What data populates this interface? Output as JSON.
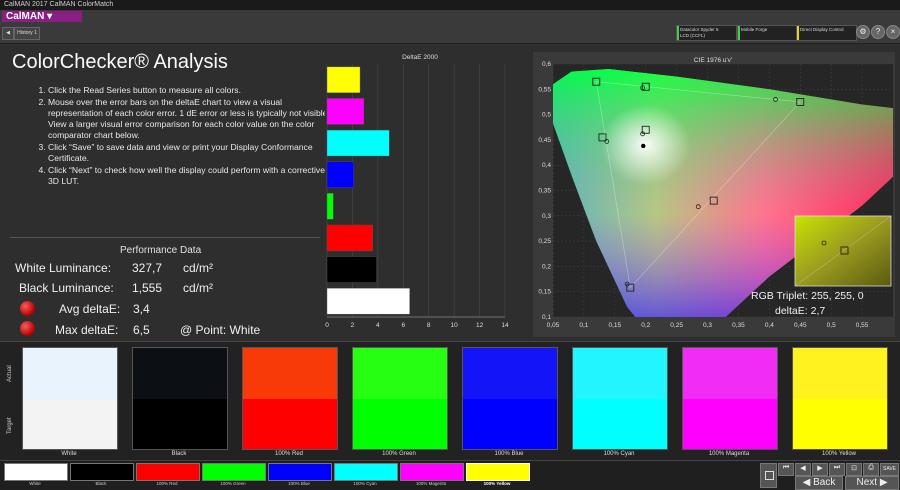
{
  "window": {
    "title": "CalMAN 2017 CalMAN ColorMatch"
  },
  "app": {
    "logo": "CalMAN ▾"
  },
  "history": {
    "tab_label": "History 1",
    "arrow": "◀"
  },
  "devices": [
    {
      "line1": "Datacolor Spyder 5",
      "line2": "LCD (CCFL)",
      "color": "#3fd14a"
    },
    {
      "line1": "Mobile Forge",
      "line2": "",
      "color": "#3fd14a"
    },
    {
      "line1": "Direct Display Control",
      "line2": "",
      "color": "#e8d21c"
    }
  ],
  "title_icons": [
    "gear-icon",
    "help-icon",
    "close-icon"
  ],
  "page": {
    "title": "ColorChecker® Analysis",
    "instructions": [
      "Click the Read Series button to measure all colors.",
      "Mouse over the error bars on the deltaE chart to view a visual representation of each color error. 1 dE error or less is typically not visible.",
      "View a larger visual error comparison for each color value on the color comparator chart below.",
      "Click “Save” to save data and view or print your Display Conformance Certificate.",
      "Click “Next” to check how well the display could perform with a corrective 3D LUT."
    ]
  },
  "performance": {
    "title": "Performance Data",
    "white_label": "White Luminance:",
    "white_value": "327,7",
    "white_unit": "cd/m²",
    "black_label": "Black Luminance:",
    "black_value": "1,555",
    "black_unit": "cd/m²",
    "avg_label": "Avg deltaE:",
    "avg_value": "3,4",
    "max_label": "Max deltaE:",
    "max_value": "6,5",
    "point_label": "@ Point: White"
  },
  "chart_data": [
    {
      "type": "bar",
      "title": "DeltaE 2000",
      "orientation": "horizontal",
      "categories": [
        "100% Yellow",
        "100% Magenta",
        "100% Cyan",
        "100% Blue",
        "100% Green",
        "100% Red",
        "Black",
        "White"
      ],
      "values": [
        2.6,
        2.9,
        4.9,
        2.1,
        0.5,
        3.6,
        3.9,
        6.5
      ],
      "colors": [
        "#ffff00",
        "#ff00ff",
        "#00ffff",
        "#0000ff",
        "#00ff00",
        "#ff0000",
        "#000000",
        "#ffffff"
      ],
      "xlim": [
        0,
        14
      ],
      "xticks": [
        "0",
        "2",
        "4",
        "6",
        "8",
        "10",
        "12",
        "14"
      ],
      "grid": true
    },
    {
      "type": "scatter",
      "title": "CIE 1976 u'v'",
      "xlim": [
        0.05,
        0.6
      ],
      "ylim": [
        0.1,
        0.6
      ],
      "xticks": [
        "0,05",
        "0,1",
        "0,15",
        "0,2",
        "0,25",
        "0,3",
        "0,35",
        "0,4",
        "0,45",
        "0,5",
        "0,55"
      ],
      "yticks": [
        "0,1",
        "0,15",
        "0,2",
        "0,25",
        "0,3",
        "0,35",
        "0,4",
        "0,45",
        "0,5",
        "0,55",
        "0,6"
      ],
      "target_points": [
        [
          0.12,
          0.565
        ],
        [
          0.2,
          0.555
        ],
        [
          0.45,
          0.525
        ],
        [
          0.13,
          0.455
        ],
        [
          0.2,
          0.47
        ],
        [
          0.31,
          0.33
        ],
        [
          0.175,
          0.158
        ]
      ],
      "measured_points": [
        [
          0.195,
          0.553
        ],
        [
          0.41,
          0.53
        ],
        [
          0.137,
          0.447
        ],
        [
          0.195,
          0.462
        ],
        [
          0.285,
          0.318
        ],
        [
          0.17,
          0.165
        ]
      ],
      "current_point": [
        0.196,
        0.438
      ],
      "readout": {
        "triplet": "RGB Triplet: 255, 255, 0",
        "deltae": "deltaE: 2,7"
      }
    }
  ],
  "comparator": {
    "actual_label": "Actual",
    "target_label": "Target",
    "swatches": [
      {
        "label": "White",
        "actual": "#e9f3fe",
        "target": "#f3f3f3"
      },
      {
        "label": "Black",
        "actual": "#0c0f14",
        "target": "#000000"
      },
      {
        "label": "100% Red",
        "actual": "#f83a08",
        "target": "#ff0000"
      },
      {
        "label": "100% Green",
        "actual": "#27ff12",
        "target": "#00ff00"
      },
      {
        "label": "100% Blue",
        "actual": "#1414f8",
        "target": "#0000ff"
      },
      {
        "label": "100% Cyan",
        "actual": "#22f5ff",
        "target": "#00ffff"
      },
      {
        "label": "100% Magenta",
        "actual": "#f12cf5",
        "target": "#ff00ff"
      },
      {
        "label": "100% Yellow",
        "actual": "#fff21e",
        "target": "#ffff00"
      }
    ]
  },
  "navigation": {
    "items": [
      {
        "label": "White",
        "color": "#ffffff"
      },
      {
        "label": "Black",
        "color": "#000000"
      },
      {
        "label": "100% Red",
        "color": "#ff0000"
      },
      {
        "label": "100% Green",
        "color": "#00ff00"
      },
      {
        "label": "100% Blue",
        "color": "#0000ff"
      },
      {
        "label": "100% Cyan",
        "color": "#00ffff"
      },
      {
        "label": "100% Magenta",
        "color": "#ff00ff"
      },
      {
        "label": "100% Yellow",
        "color": "#ffff00"
      }
    ],
    "back_label": "Back",
    "next_label": "Next",
    "save_label": "SAVE"
  }
}
